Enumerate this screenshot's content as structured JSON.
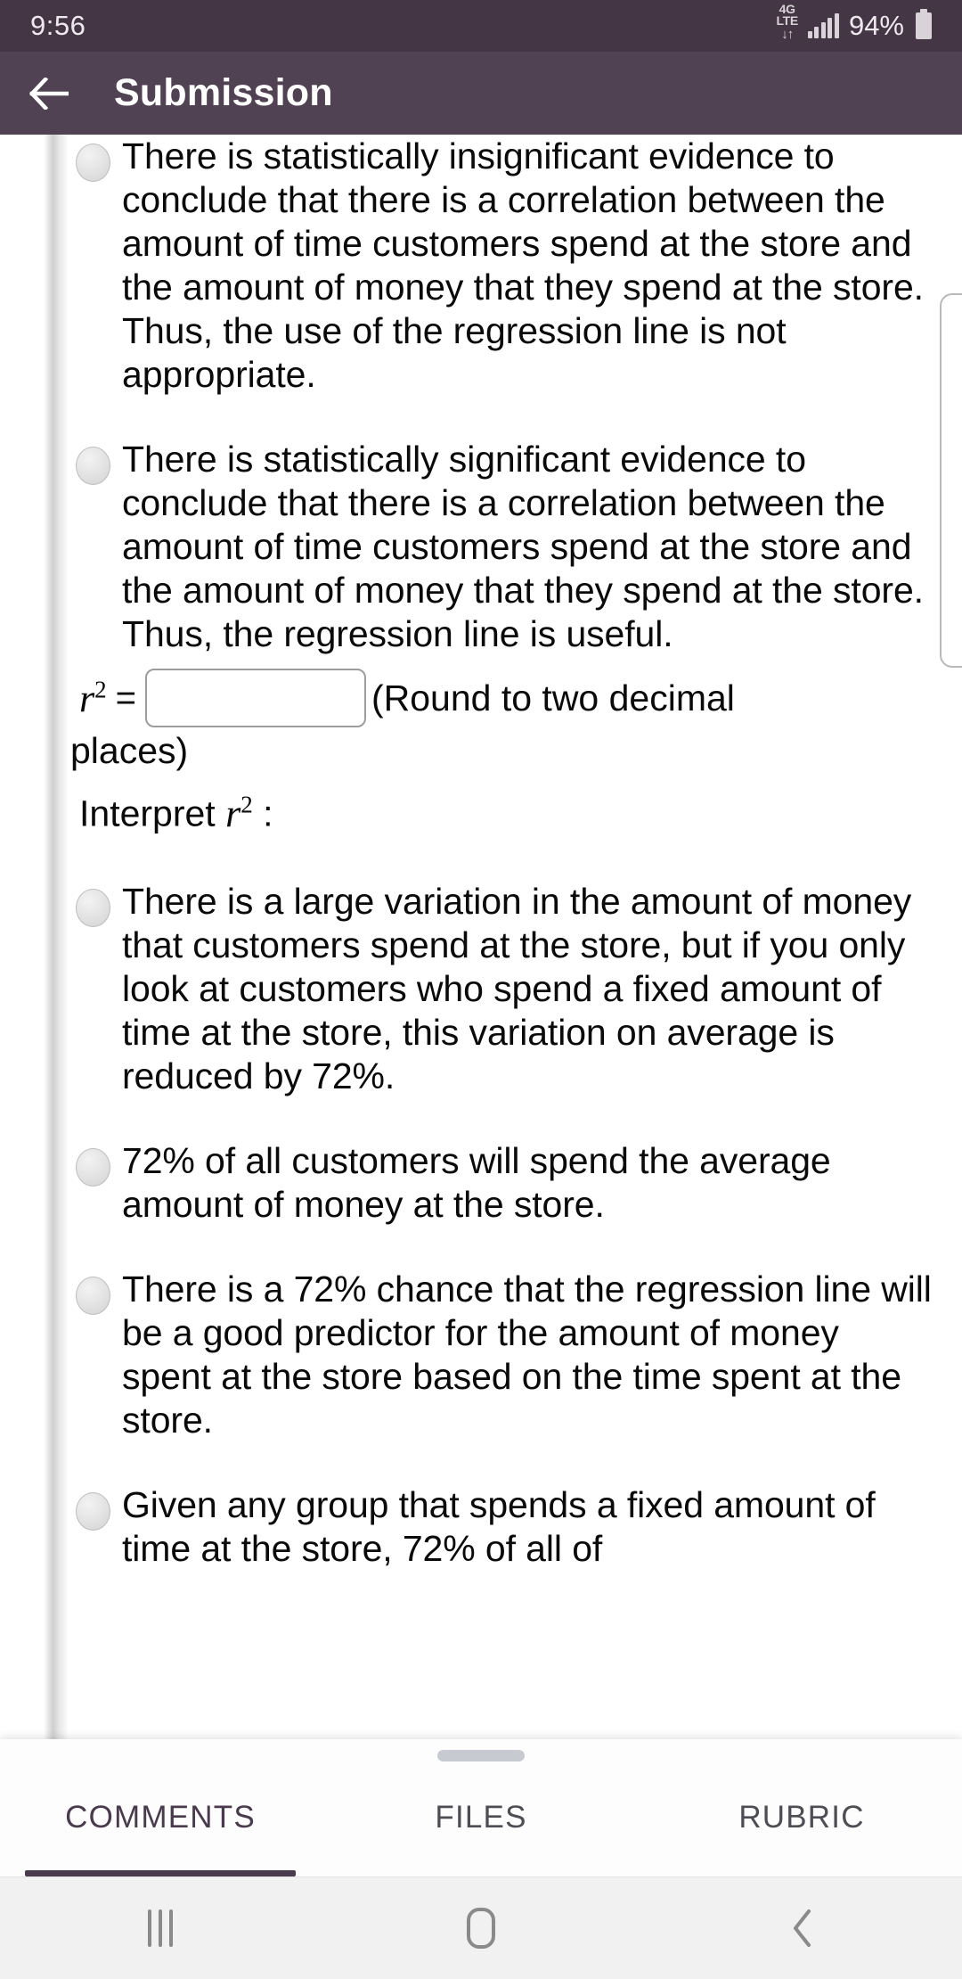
{
  "status_bar": {
    "time": "9:56",
    "network_type_top": "4G",
    "network_type_bottom": "LTE",
    "data_arrows": "↓↑",
    "battery_percent": "94%",
    "icons": {
      "signal": "signal-bars-icon",
      "battery": "battery-icon"
    }
  },
  "app_bar": {
    "title": "Submission",
    "back_icon": "back-arrow-icon"
  },
  "document": {
    "options_group_1": [
      {
        "id": "opt-insignificant",
        "text": "There is statistically insignificant evidence to conclude that there is a correlation between the amount of time customers spend at the store and the amount of money that they spend at the store. Thus, the use of the regression line is not appropriate.",
        "selected": false
      },
      {
        "id": "opt-significant",
        "text": "There is statistically significant evidence to conclude that there is a correlation between the amount of time customers spend at the store and the amount of money that they spend at the store. Thus, the regression line is useful.",
        "selected": false
      }
    ],
    "rsq_field": {
      "label_base": "r",
      "label_exponent": "2",
      "equals": "=",
      "value": "",
      "placeholder": "",
      "hint": "(Round to two decimal",
      "hint_continued": "places)"
    },
    "interpret_prompt": {
      "prefix": "Interpret ",
      "base": "r",
      "exponent": "2",
      "suffix": " :"
    },
    "options_group_2": [
      {
        "id": "opt-large-variation",
        "text": "There is a large variation in the amount of money that customers spend at the store, but if you only look at customers who spend a fixed amount of time at the store, this variation on average is reduced by 72%.",
        "selected": false
      },
      {
        "id": "opt-72-average",
        "text": "72% of all customers will spend the average amount of money at the store.",
        "selected": false
      },
      {
        "id": "opt-72-chance",
        "text": "There is a 72% chance that the regression line will be a good predictor for the amount of money spent at the store based on the time spent at the store.",
        "selected": false
      },
      {
        "id": "opt-given-group",
        "text": "Given any group that spends a fixed amount of time at the store, 72% of all of",
        "selected": false
      }
    ]
  },
  "bottom_tabs": {
    "items": [
      {
        "label": "COMMENTS",
        "active": true
      },
      {
        "label": "FILES",
        "active": false
      },
      {
        "label": "RUBRIC",
        "active": false
      }
    ]
  },
  "nav_bar": {
    "recent_label": "recent-apps-icon",
    "home_label": "home-icon",
    "back_label": "back-icon"
  },
  "colors": {
    "status_bar_bg": "#443644",
    "app_bar_bg": "#514253",
    "accent": "#4a3a4d",
    "page_bg": "#ffffff",
    "nav_bar_bg": "#f1f1f1"
  }
}
